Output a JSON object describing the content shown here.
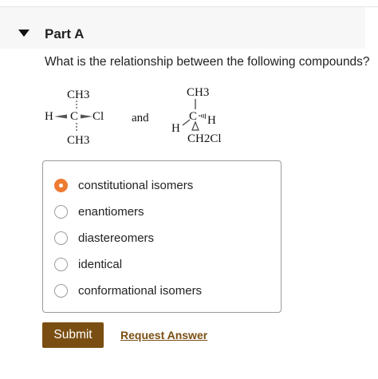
{
  "section": {
    "title": "Part A"
  },
  "question": {
    "text": "What is the relationship between the following compounds?"
  },
  "compounds": {
    "left": {
      "top": "CH3",
      "left": "H",
      "center": "C",
      "right": "Cl",
      "bottom": "CH3"
    },
    "connector": "and",
    "right": {
      "top": "CH3",
      "center": "C",
      "right": "H",
      "left": "H",
      "bottom": "CH2Cl"
    }
  },
  "options": [
    {
      "label": "constitutional isomers",
      "selected": true
    },
    {
      "label": "enantiomers",
      "selected": false
    },
    {
      "label": "diastereomers",
      "selected": false
    },
    {
      "label": "identical",
      "selected": false
    },
    {
      "label": "conformational isomers",
      "selected": false
    }
  ],
  "actions": {
    "submit_label": "Submit",
    "request_label": "Request Answer"
  },
  "colors": {
    "accent": "#ee7b32",
    "brand": "#7a4e12",
    "header_bg": "#f7f7f7"
  }
}
